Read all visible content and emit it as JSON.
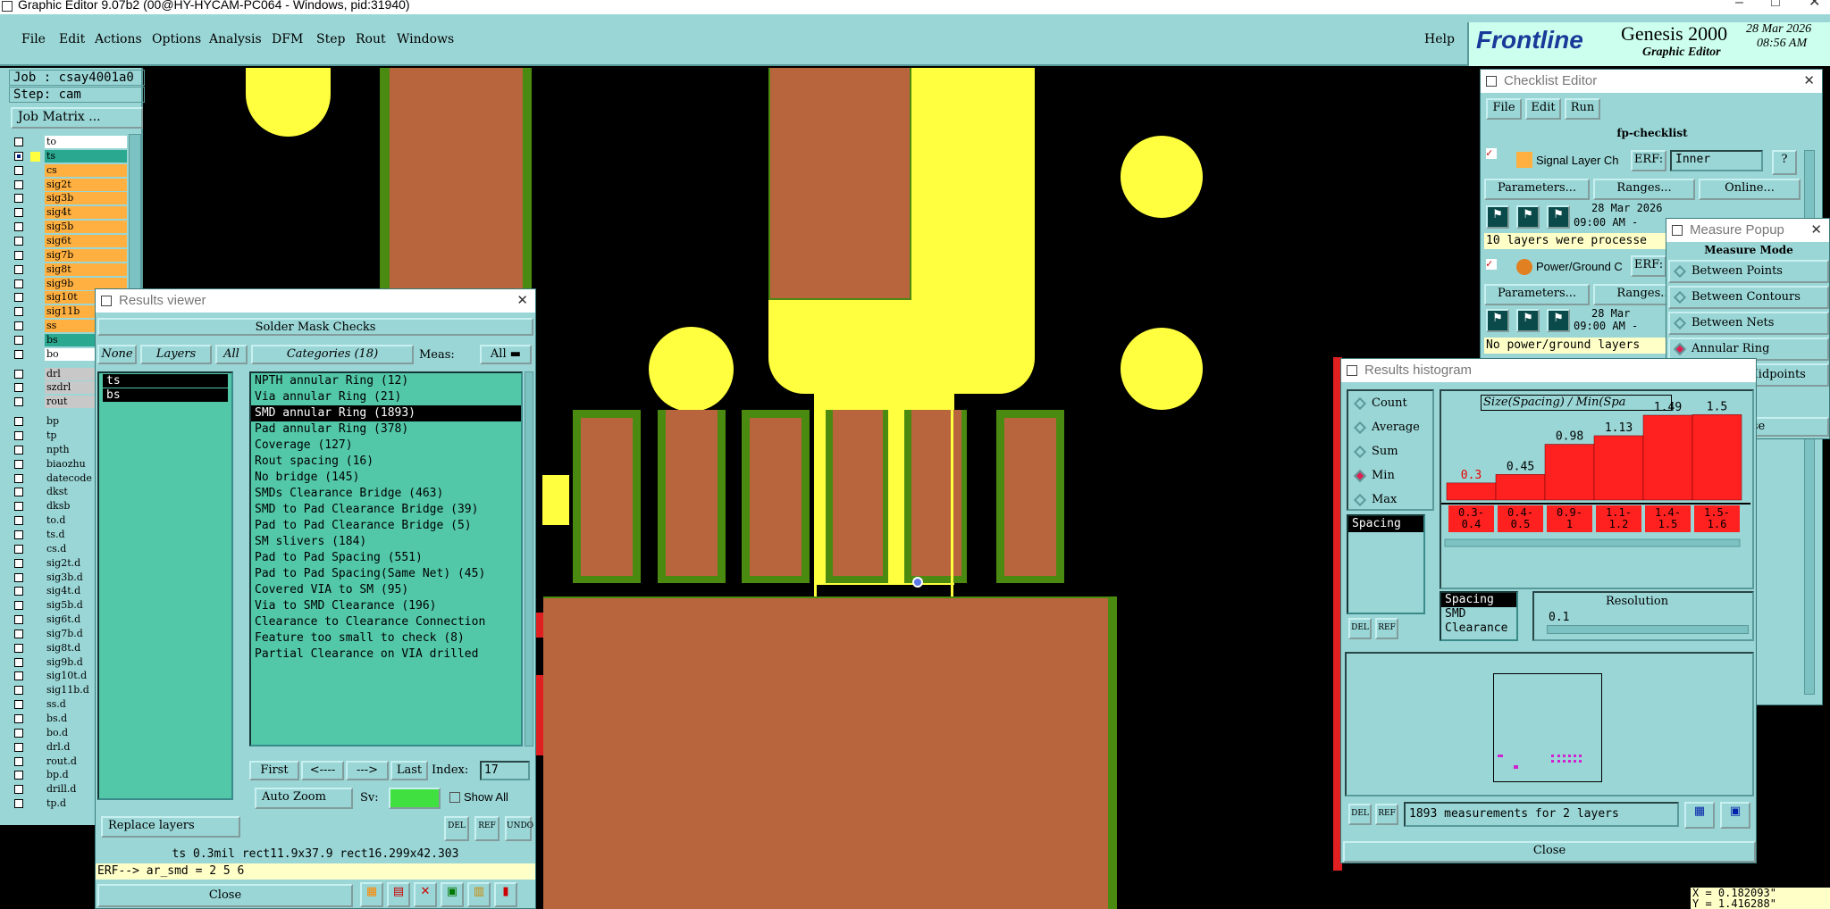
{
  "window": {
    "title": "Graphic Editor 9.07b2 (00@HY-HYCAM-PC064 - Windows, pid:31940)"
  },
  "menu": {
    "items": [
      "File",
      "Edit",
      "Actions",
      "Options",
      "Analysis",
      "DFM",
      "Step",
      "Rout",
      "Windows"
    ],
    "help": "Help"
  },
  "brand": {
    "logo": "Frontline",
    "product": "Genesis 2000",
    "subtitle": "Graphic Editor",
    "date": "28 Mar 2026",
    "time": "08:56 AM"
  },
  "job": {
    "job_label": "Job : csay4001a0",
    "step_label": "Step: cam",
    "matrix_button": "Job Matrix ..."
  },
  "layers": [
    {
      "name": "to",
      "color": "#ffffff",
      "checked": false
    },
    {
      "name": "ts",
      "color": "#2aa890",
      "checked": true
    },
    {
      "name": "cs",
      "color": "#ffb040",
      "checked": false
    },
    {
      "name": "sig2t",
      "color": "#ffb040",
      "checked": false
    },
    {
      "name": "sig3b",
      "color": "#ffb040",
      "checked": false
    },
    {
      "name": "sig4t",
      "color": "#ffb040",
      "checked": false
    },
    {
      "name": "sig5b",
      "color": "#ffb040",
      "checked": false
    },
    {
      "name": "sig6t",
      "color": "#ffb040",
      "checked": false
    },
    {
      "name": "sig7b",
      "color": "#ffb040",
      "checked": false
    },
    {
      "name": "sig8t",
      "color": "#ffb040",
      "checked": false
    },
    {
      "name": "sig9b",
      "color": "#ffb040",
      "checked": false
    },
    {
      "name": "sig10t",
      "color": "#ffb040",
      "checked": false
    },
    {
      "name": "sig11b",
      "color": "#ffb040",
      "checked": false
    },
    {
      "name": "ss",
      "color": "#ffb040",
      "checked": false
    },
    {
      "name": "bs",
      "color": "#2aa890",
      "checked": false
    },
    {
      "name": "bo",
      "color": "#ffffff",
      "checked": false
    },
    {
      "name": "drl",
      "color": "#c8c8c8",
      "checked": false
    },
    {
      "name": "szdrl",
      "color": "#c8c8c8",
      "checked": false
    },
    {
      "name": "rout",
      "color": "#c8c8c8",
      "checked": false
    },
    {
      "name": "bp",
      "color": "#9ad6d6",
      "checked": false
    },
    {
      "name": "tp",
      "color": "#9ad6d6",
      "checked": false
    },
    {
      "name": "npth",
      "color": "#9ad6d6",
      "checked": false
    },
    {
      "name": "biaozhu",
      "color": "#9ad6d6",
      "checked": false
    },
    {
      "name": "datecode",
      "color": "#9ad6d6",
      "checked": false
    },
    {
      "name": "dkst",
      "color": "#9ad6d6",
      "checked": false
    },
    {
      "name": "dksb",
      "color": "#9ad6d6",
      "checked": false
    },
    {
      "name": "to.d",
      "color": "#9ad6d6",
      "checked": false
    },
    {
      "name": "ts.d",
      "color": "#9ad6d6",
      "checked": false
    },
    {
      "name": "cs.d",
      "color": "#9ad6d6",
      "checked": false
    },
    {
      "name": "sig2t.d",
      "color": "#9ad6d6",
      "checked": false
    },
    {
      "name": "sig3b.d",
      "color": "#9ad6d6",
      "checked": false
    },
    {
      "name": "sig4t.d",
      "color": "#9ad6d6",
      "checked": false
    },
    {
      "name": "sig5b.d",
      "color": "#9ad6d6",
      "checked": false
    },
    {
      "name": "sig6t.d",
      "color": "#9ad6d6",
      "checked": false
    },
    {
      "name": "sig7b.d",
      "color": "#9ad6d6",
      "checked": false
    },
    {
      "name": "sig8t.d",
      "color": "#9ad6d6",
      "checked": false
    },
    {
      "name": "sig9b.d",
      "color": "#9ad6d6",
      "checked": false
    },
    {
      "name": "sig10t.d",
      "color": "#9ad6d6",
      "checked": false
    },
    {
      "name": "sig11b.d",
      "color": "#9ad6d6",
      "checked": false
    },
    {
      "name": "ss.d",
      "color": "#9ad6d6",
      "checked": false
    },
    {
      "name": "bs.d",
      "color": "#9ad6d6",
      "checked": false
    },
    {
      "name": "bo.d",
      "color": "#9ad6d6",
      "checked": false
    },
    {
      "name": "drl.d",
      "color": "#9ad6d6",
      "checked": false
    },
    {
      "name": "rout.d",
      "color": "#9ad6d6",
      "checked": false
    },
    {
      "name": "bp.d",
      "color": "#9ad6d6",
      "checked": false
    },
    {
      "name": "drill.d",
      "color": "#9ad6d6",
      "checked": false
    },
    {
      "name": "tp.d",
      "color": "#9ad6d6",
      "checked": false
    }
  ],
  "results_viewer": {
    "title": "Results viewer",
    "header": "Solder Mask Checks",
    "none": "None",
    "layers_label": "Layers",
    "all": "All",
    "categories_label": "Categories (18)",
    "meas_label": "Meas:",
    "meas_value": "All",
    "layer_items": [
      "ts",
      "bs"
    ],
    "categories": [
      "NPTH annular Ring (12)",
      "Via annular Ring (21)",
      "SMD annular Ring (1893)",
      "Pad annular Ring (378)",
      "Coverage (127)",
      "Rout spacing (16)",
      "No bridge (145)",
      "SMDs Clearance Bridge (463)",
      "SMD to Pad Clearance Bridge (39)",
      "Pad to Pad Clearance Bridge (5)",
      "SM slivers (184)",
      "Pad to Pad Spacing (551)",
      "Pad to Pad Spacing(Same Net) (45)",
      "Covered VIA to SM (95)",
      "Via to SMD Clearance (196)",
      "Clearance to Clearance Connection",
      "Feature too small to check (8)",
      "Partial Clearance on VIA drilled"
    ],
    "selected_index": 2,
    "nav": {
      "first": "First",
      "prev": "<----",
      "next": "--->",
      "last": "Last",
      "index_label": "Index:",
      "index_value": "17"
    },
    "auto_zoom": "Auto Zoom",
    "sv": "Sv:",
    "show_all": "Show All",
    "replace": "Replace layers",
    "status": "ts 0.3mil  rect11.9x37.9  rect16.299x42.303",
    "erf": "ERF--> ar_smd = 2 5 6",
    "close": "Close",
    "icon_labels": [
      "DEL",
      "REF",
      "UNDO"
    ]
  },
  "checklist": {
    "title": "Checklist Editor",
    "menu": [
      "File",
      "Edit",
      "Run"
    ],
    "name": "fp-checklist",
    "rows": [
      {
        "label": "Signal Layer Ch",
        "erf": "ERF:",
        "erf_value": "Inner",
        "params": "Parameters...",
        "ranges": "Ranges...",
        "online": "Online...",
        "date": "28 Mar 2026",
        "time": "09:00 AM -",
        "msg": "10 layers were processe"
      },
      {
        "label": "Power/Ground C",
        "erf": "ERF:",
        "erf_value": "",
        "params": "Parameters...",
        "ranges": "Ranges...",
        "online": "",
        "date": "28 Mar",
        "time": "09:00 AM -",
        "msg": "No power/ground layers"
      }
    ]
  },
  "measure": {
    "title": "Measure Popup",
    "mode_label": "Measure Mode",
    "modes": [
      "Between Points",
      "Between Contours",
      "Between Nets",
      "Annular Ring",
      "Between Midpoints"
    ],
    "selected": 3,
    "close": "Close"
  },
  "histogram": {
    "title": "Results histogram",
    "graph_title": "Size(Spacing) / Min(Spa",
    "stats": [
      "Count",
      "Average",
      "Sum",
      "Min",
      "Max"
    ],
    "selected_stat": 3,
    "list_items": [
      "Spacing"
    ],
    "type_items": [
      "Spacing",
      "SMD",
      "Clearance"
    ],
    "resolution_label": "Resolution",
    "resolution_value": "0.1",
    "footer": "1893 measurements for 2 layers",
    "close": "Close",
    "icon_labels": [
      "DEL",
      "REF"
    ]
  },
  "chart_data": {
    "type": "bar",
    "categories": [
      "0.3-0.4",
      "0.4-0.5",
      "0.9-1",
      "1.1-1.2",
      "1.4-1.5",
      "1.5-1.6"
    ],
    "values": [
      0.3,
      0.45,
      0.98,
      1.13,
      1.49,
      1.5
    ],
    "ylim": [
      0,
      1.6
    ],
    "bar_color": "#ff2020"
  },
  "coords": {
    "x": "X = 0.182093\"",
    "y": "Y = 1.416288\""
  }
}
